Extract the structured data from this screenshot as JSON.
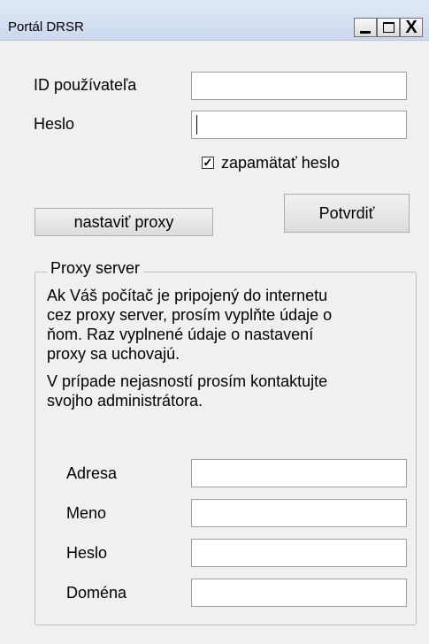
{
  "window": {
    "title": "Portál DRSR",
    "controls": {
      "minimize": "_",
      "maximize": "□",
      "close": "X"
    }
  },
  "login": {
    "user_id_label": "ID používateľa",
    "user_id_value": "",
    "password_label": "Heslo",
    "password_value": "",
    "remember_label": "zapamätať heslo",
    "remember_checked": true,
    "proxy_button": "nastaviť proxy",
    "confirm_button": "Potvrdiť"
  },
  "proxy": {
    "group_title": "Proxy server",
    "info_lines": [
      "Ak Váš počítač je pripojený do internetu",
      "cez proxy server, prosím vyplňte údaje o",
      "ňom. Raz vyplnené údaje o nastavení",
      "proxy sa uchovajú."
    ],
    "contact_lines": [
      "V prípade nejasností prosím kontaktujte",
      "svojho administrátora."
    ],
    "address_label": "Adresa",
    "address_value": "",
    "name_label": "Meno",
    "name_value": "",
    "password_label": "Heslo",
    "password_value": "",
    "domain_label": "Doména",
    "domain_value": ""
  }
}
